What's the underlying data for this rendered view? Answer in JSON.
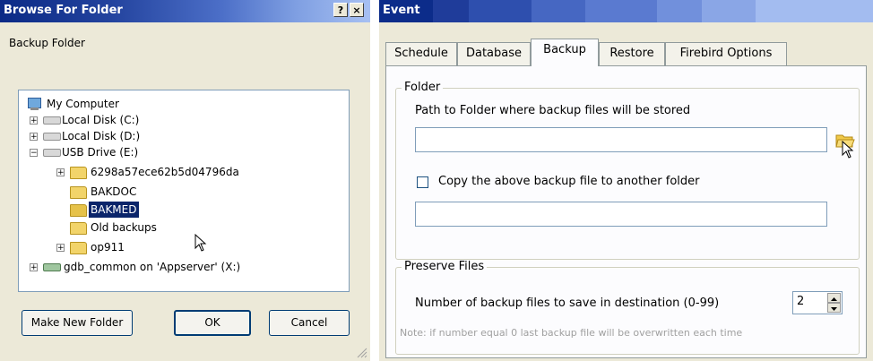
{
  "browse": {
    "title": "Browse For Folder",
    "help_glyph": "?",
    "close_glyph": "×",
    "caption": "Backup Folder",
    "tree": [
      {
        "label": "My Computer",
        "expander": ""
      },
      {
        "label": "Local Disk (C:)",
        "expander": "+"
      },
      {
        "label": "Local Disk (D:)",
        "expander": "+"
      },
      {
        "label": "USB Drive (E:)",
        "expander": "−"
      },
      {
        "label": "6298a57ece62b5d04796da",
        "expander": "+"
      },
      {
        "label": "BAKDOC",
        "expander": ""
      },
      {
        "label": "BAKMED",
        "expander": "",
        "selected": true
      },
      {
        "label": "Old backups",
        "expander": ""
      },
      {
        "label": "op911",
        "expander": "+"
      },
      {
        "label": "gdb_common on 'Appserver' (X:)",
        "expander": "+"
      }
    ],
    "buttons": {
      "make_new_folder": "Make New Folder",
      "ok": "OK",
      "cancel": "Cancel"
    }
  },
  "event": {
    "title": "Event",
    "tabs": [
      {
        "label": "Schedule",
        "active": false
      },
      {
        "label": "Database",
        "active": false
      },
      {
        "label": "Backup",
        "active": true
      },
      {
        "label": "Restore",
        "active": false
      },
      {
        "label": "Firebird Options",
        "active": false
      }
    ],
    "folder_group": {
      "title": "Folder",
      "path_label": "Path to Folder where backup files will be stored",
      "path_value": "",
      "copy_label": "Copy the above backup file to another folder",
      "copy_checked": false,
      "copy_value": ""
    },
    "preserve_group": {
      "title": "Preserve Files",
      "count_label": "Number of backup files to save in destination (0-99)",
      "count_value": "2",
      "note": "Note:  if number equal 0 last backup file will be overwritten each time"
    }
  },
  "colors": {
    "title_dark": "#0b2a86",
    "selection": "#0a246a",
    "face": "#ece9d8"
  }
}
